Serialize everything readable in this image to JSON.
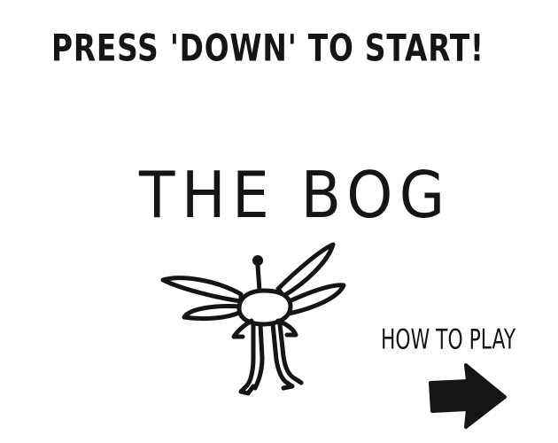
{
  "screen": {
    "start_prompt": "PRESS 'DOWN' TO START!",
    "title": "THE BOG",
    "how_to_play": "HOW TO PLAY"
  },
  "icons": {
    "creature": "dragonfly-creature-icon",
    "arrow": "right-arrow-icon"
  },
  "colors": {
    "background": "#ffffff",
    "ink": "#151515"
  }
}
